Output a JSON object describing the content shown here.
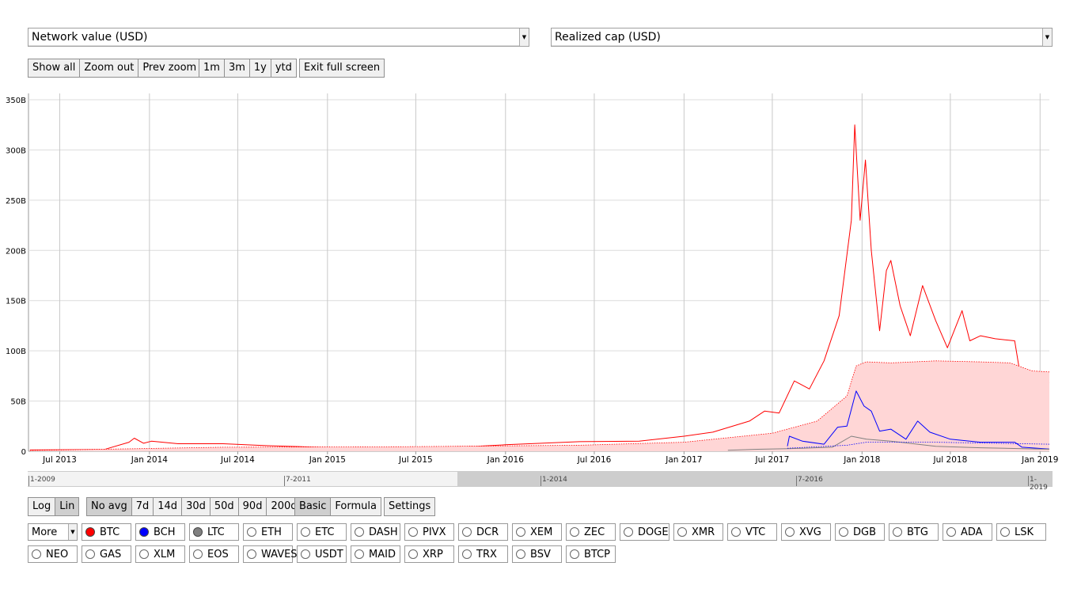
{
  "selects": {
    "left_metric": "Network value (USD)",
    "right_metric": "Realized cap (USD)"
  },
  "zoom_buttons": [
    "Show all",
    "Zoom out",
    "Prev zoom"
  ],
  "range_buttons": [
    "1m",
    "3m",
    "1y",
    "ytd"
  ],
  "fullscreen_button": "Exit full screen",
  "scale_buttons": [
    {
      "label": "Log",
      "active": false
    },
    {
      "label": "Lin",
      "active": true
    }
  ],
  "avg_buttons": [
    {
      "label": "No avg",
      "active": true
    },
    {
      "label": "7d",
      "active": false
    },
    {
      "label": "14d",
      "active": false
    },
    {
      "label": "30d",
      "active": false
    },
    {
      "label": "50d",
      "active": false
    },
    {
      "label": "90d",
      "active": false
    },
    {
      "label": "200d",
      "active": false
    }
  ],
  "mode_buttons": [
    {
      "label": "Basic",
      "active": true
    },
    {
      "label": "Formula",
      "active": false
    }
  ],
  "settings_button": "Settings",
  "more_select": "More",
  "coins_row1": [
    {
      "name": "BTC",
      "color": "#ff0000"
    },
    {
      "name": "BCH",
      "color": "#0000ff"
    },
    {
      "name": "LTC",
      "color": "#808080"
    },
    {
      "name": "ETH"
    },
    {
      "name": "ETC"
    },
    {
      "name": "DASH"
    },
    {
      "name": "PIVX"
    },
    {
      "name": "DCR"
    },
    {
      "name": "XEM"
    },
    {
      "name": "ZEC"
    },
    {
      "name": "DOGE"
    },
    {
      "name": "XMR"
    },
    {
      "name": "VTC"
    },
    {
      "name": "XVG"
    },
    {
      "name": "DGB"
    },
    {
      "name": "BTG"
    },
    {
      "name": "ADA"
    },
    {
      "name": "LSK"
    }
  ],
  "coins_row2": [
    {
      "name": "NEO"
    },
    {
      "name": "GAS"
    },
    {
      "name": "XLM"
    },
    {
      "name": "EOS"
    },
    {
      "name": "WAVES"
    },
    {
      "name": "USDT"
    },
    {
      "name": "MAID"
    },
    {
      "name": "XRP"
    },
    {
      "name": "TRX"
    },
    {
      "name": "BSV"
    },
    {
      "name": "BTCP"
    }
  ],
  "navigator": {
    "labels": [
      "1-2009",
      "7-2011",
      "1-2014",
      "7-2016",
      "1-2019"
    ],
    "selection": [
      "2013-04",
      "2019-01"
    ]
  },
  "chart_data": {
    "type": "line",
    "x_range": [
      "2013-04-28",
      "2019-01-20"
    ],
    "ylim": [
      0,
      350
    ],
    "y_unit": "B",
    "y_ticks": [
      "0",
      "50B",
      "100B",
      "150B",
      "200B",
      "250B",
      "300B",
      "350B"
    ],
    "x_ticks": [
      "Jul 2013",
      "Jan 2014",
      "Jul 2014",
      "Jan 2015",
      "Jul 2015",
      "Jan 2016",
      "Jul 2016",
      "Jan 2017",
      "Jul 2017",
      "Jan 2018",
      "Jul 2018",
      "Jan 2019"
    ],
    "grid": true,
    "series": [
      {
        "name": "BTC",
        "color": "#ff0000",
        "style": "line",
        "points": [
          [
            "2013-05-01",
            1.3
          ],
          [
            "2013-10-01",
            1.8
          ],
          [
            "2013-11-20",
            9
          ],
          [
            "2013-12-01",
            13
          ],
          [
            "2013-12-20",
            8
          ],
          [
            "2014-01-05",
            10
          ],
          [
            "2014-03-01",
            7.5
          ],
          [
            "2014-06-01",
            7.5
          ],
          [
            "2014-09-01",
            5.5
          ],
          [
            "2015-01-01",
            3.8
          ],
          [
            "2015-06-01",
            3.5
          ],
          [
            "2015-11-01",
            5
          ],
          [
            "2016-01-01",
            6.5
          ],
          [
            "2016-06-01",
            9.5
          ],
          [
            "2016-10-01",
            10
          ],
          [
            "2017-01-01",
            15
          ],
          [
            "2017-03-01",
            19
          ],
          [
            "2017-05-15",
            30
          ],
          [
            "2017-06-15",
            40
          ],
          [
            "2017-07-15",
            38
          ],
          [
            "2017-08-15",
            70
          ],
          [
            "2017-09-15",
            62
          ],
          [
            "2017-10-15",
            90
          ],
          [
            "2017-11-15",
            135
          ],
          [
            "2017-12-10",
            230
          ],
          [
            "2017-12-17",
            325
          ],
          [
            "2017-12-28",
            230
          ],
          [
            "2018-01-08",
            290
          ],
          [
            "2018-01-20",
            200
          ],
          [
            "2018-02-06",
            120
          ],
          [
            "2018-02-20",
            180
          ],
          [
            "2018-03-01",
            190
          ],
          [
            "2018-03-20",
            145
          ],
          [
            "2018-04-10",
            115
          ],
          [
            "2018-05-05",
            165
          ],
          [
            "2018-06-01",
            130
          ],
          [
            "2018-06-25",
            103
          ],
          [
            "2018-07-25",
            140
          ],
          [
            "2018-08-10",
            110
          ],
          [
            "2018-09-01",
            115
          ],
          [
            "2018-10-01",
            112
          ],
          [
            "2018-11-10",
            110
          ],
          [
            "2018-11-20",
            80
          ],
          [
            "2018-12-15",
            57
          ],
          [
            "2019-01-10",
            70
          ],
          [
            "2019-01-20",
            68
          ]
        ]
      },
      {
        "name": "BTC realized cap",
        "color": "#ff0000",
        "style": "area",
        "points": [
          [
            "2013-05-01",
            0.8
          ],
          [
            "2013-12-01",
            2.5
          ],
          [
            "2014-06-01",
            4
          ],
          [
            "2015-06-01",
            4.5
          ],
          [
            "2016-06-01",
            6
          ],
          [
            "2017-01-01",
            9
          ],
          [
            "2017-07-01",
            18
          ],
          [
            "2017-10-01",
            30
          ],
          [
            "2017-12-01",
            55
          ],
          [
            "2017-12-20",
            85
          ],
          [
            "2018-01-10",
            89
          ],
          [
            "2018-03-01",
            88
          ],
          [
            "2018-06-01",
            90
          ],
          [
            "2018-09-01",
            89
          ],
          [
            "2018-11-01",
            88
          ],
          [
            "2018-12-15",
            80
          ],
          [
            "2019-01-20",
            79
          ]
        ]
      },
      {
        "name": "BCH",
        "color": "#0000ff",
        "style": "line",
        "points": [
          [
            "2017-08-01",
            5
          ],
          [
            "2017-08-05",
            15
          ],
          [
            "2017-09-01",
            10
          ],
          [
            "2017-10-15",
            7
          ],
          [
            "2017-11-12",
            24
          ],
          [
            "2017-12-01",
            25
          ],
          [
            "2017-12-20",
            60
          ],
          [
            "2018-01-05",
            45
          ],
          [
            "2018-01-20",
            40
          ],
          [
            "2018-02-06",
            20
          ],
          [
            "2018-03-01",
            22
          ],
          [
            "2018-04-01",
            12
          ],
          [
            "2018-04-25",
            30
          ],
          [
            "2018-05-20",
            19
          ],
          [
            "2018-07-01",
            12
          ],
          [
            "2018-09-01",
            9
          ],
          [
            "2018-11-10",
            9
          ],
          [
            "2018-11-25",
            4
          ],
          [
            "2019-01-20",
            2.2
          ]
        ]
      },
      {
        "name": "LTC",
        "color": "#808080",
        "style": "line",
        "points": [
          [
            "2017-04-01",
            1
          ],
          [
            "2017-06-01",
            2
          ],
          [
            "2017-08-01",
            2.5
          ],
          [
            "2017-11-01",
            4
          ],
          [
            "2017-12-10",
            15
          ],
          [
            "2018-01-10",
            12
          ],
          [
            "2018-03-01",
            10
          ],
          [
            "2018-06-01",
            5
          ],
          [
            "2018-09-01",
            3.5
          ],
          [
            "2019-01-20",
            2
          ]
        ]
      },
      {
        "name": "BCH realized cap",
        "color": "#0000ff",
        "style": "dotted",
        "points": [
          [
            "2017-08-01",
            3
          ],
          [
            "2017-12-01",
            6
          ],
          [
            "2018-01-10",
            9
          ],
          [
            "2018-06-01",
            9
          ],
          [
            "2019-01-20",
            7
          ]
        ]
      }
    ]
  }
}
